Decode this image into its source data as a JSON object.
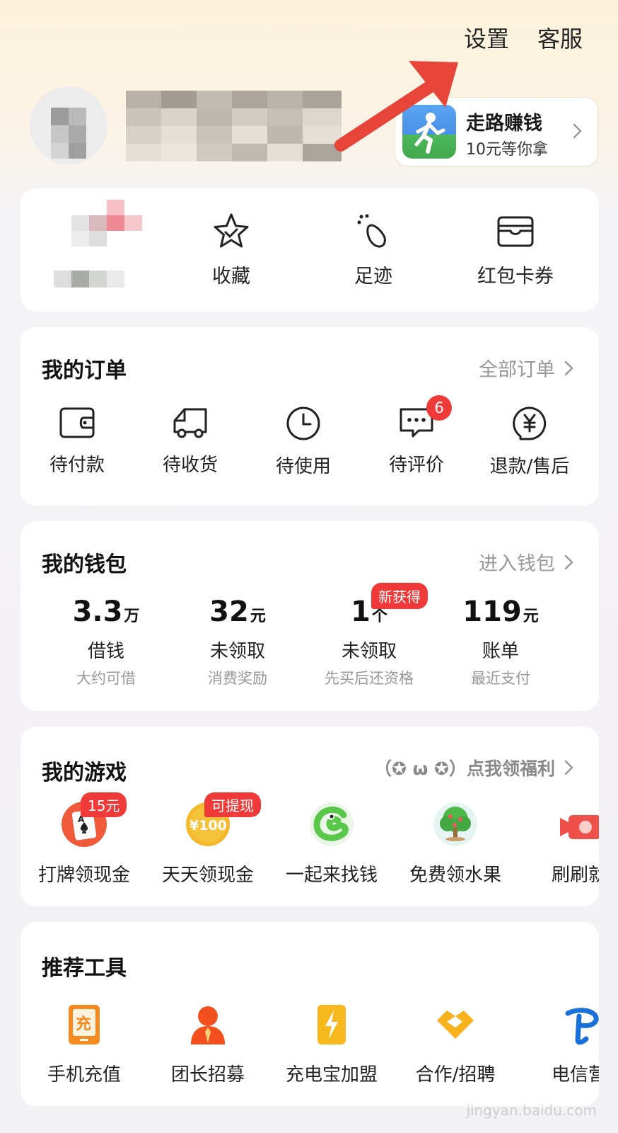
{
  "header": {
    "settings": "设置",
    "service": "客服"
  },
  "walk": {
    "title": "走路赚钱",
    "subtitle": "10元等你拿"
  },
  "quick": [
    {
      "label": "收藏",
      "icon": "star-icon"
    },
    {
      "label": "足迹",
      "icon": "footprint-icon"
    },
    {
      "label": "红包卡券",
      "icon": "wallet-card-icon"
    }
  ],
  "orders": {
    "title": "我的订单",
    "more": "全部订单",
    "items": [
      {
        "label": "待付款",
        "icon": "wallet-icon"
      },
      {
        "label": "待收货",
        "icon": "truck-icon"
      },
      {
        "label": "待使用",
        "icon": "clock-icon"
      },
      {
        "label": "待评价",
        "icon": "comment-icon",
        "badge": "6"
      },
      {
        "label": "退款/售后",
        "icon": "refund-icon"
      }
    ]
  },
  "wallet": {
    "title": "我的钱包",
    "more": "进入钱包",
    "items": [
      {
        "value": "3.3",
        "unit": "万",
        "label": "借钱",
        "sub": "大约可借"
      },
      {
        "value": "32",
        "unit": "元",
        "label": "未领取",
        "sub": "消费奖励"
      },
      {
        "value": "1",
        "unit": "个",
        "label": "未领取",
        "sub": "先买后还资格",
        "badge": "新获得"
      },
      {
        "value": "119",
        "unit": "元",
        "label": "账单",
        "sub": "最近支付"
      }
    ]
  },
  "games": {
    "title": "我的游戏",
    "more": "（✪ ω ✪）点我领福利",
    "items": [
      {
        "label": "打牌领现金",
        "badge": "15元",
        "icon": "poker-icon"
      },
      {
        "label": "天天领现金",
        "badge": "可提现",
        "icon": "coin-icon",
        "coin_text": "¥100"
      },
      {
        "label": "一起来找钱",
        "icon": "snake-icon"
      },
      {
        "label": "免费领水果",
        "icon": "tree-icon"
      },
      {
        "label": "刷刷就",
        "icon": "video-icon"
      }
    ]
  },
  "tools": {
    "title": "推荐工具",
    "items": [
      {
        "label": "手机充值",
        "icon": "phone-recharge-icon",
        "glyph": "充"
      },
      {
        "label": "团长招募",
        "icon": "leader-icon"
      },
      {
        "label": "充电宝加盟",
        "icon": "power-bank-icon"
      },
      {
        "label": "合作/招聘",
        "icon": "handshake-icon"
      },
      {
        "label": "电信营",
        "icon": "telecom-icon"
      }
    ]
  },
  "watermark": "jingyan.baidu.com"
}
